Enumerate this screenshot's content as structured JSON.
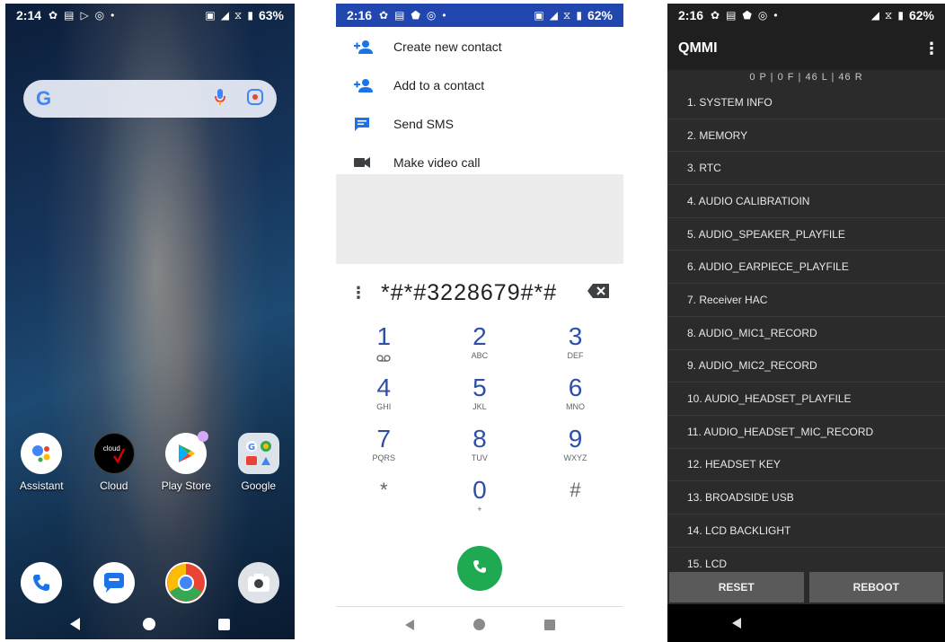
{
  "screen1": {
    "status": {
      "time": "2:14",
      "battery": "63%"
    },
    "search": {
      "logo": "G"
    },
    "apps_row1": [
      {
        "label": "Assistant",
        "icon": "assistant-icon"
      },
      {
        "label": "Cloud",
        "icon": "cloud-icon",
        "inner": "cloud"
      },
      {
        "label": "Play Store",
        "icon": "play-store-icon"
      },
      {
        "label": "Google",
        "icon": "google-folder-icon"
      }
    ],
    "dock": [
      {
        "icon": "phone-icon"
      },
      {
        "icon": "messages-icon"
      },
      {
        "icon": "chrome-icon"
      },
      {
        "icon": "camera-icon"
      }
    ]
  },
  "screen2": {
    "status": {
      "time": "2:16",
      "battery": "62%"
    },
    "menu": [
      {
        "label": "Create new contact",
        "icon": "add-person-icon"
      },
      {
        "label": "Add to a contact",
        "icon": "add-person-icon"
      },
      {
        "label": "Send SMS",
        "icon": "sms-icon"
      },
      {
        "label": "Make video call",
        "icon": "video-call-icon"
      }
    ],
    "dialed_number": "*#*#3228679#*#",
    "keypad": [
      [
        {
          "digit": "1",
          "letters": ""
        },
        {
          "digit": "2",
          "letters": "ABC"
        },
        {
          "digit": "3",
          "letters": "DEF"
        }
      ],
      [
        {
          "digit": "4",
          "letters": "GHI"
        },
        {
          "digit": "5",
          "letters": "JKL"
        },
        {
          "digit": "6",
          "letters": "MNO"
        }
      ],
      [
        {
          "digit": "7",
          "letters": "PQRS"
        },
        {
          "digit": "8",
          "letters": "TUV"
        },
        {
          "digit": "9",
          "letters": "WXYZ"
        }
      ],
      [
        {
          "digit": "*",
          "letters": ""
        },
        {
          "digit": "0",
          "letters": "+"
        },
        {
          "digit": "#",
          "letters": ""
        }
      ]
    ],
    "colors": {
      "accent": "#2e4fa8",
      "call": "#1ea952",
      "status_bar": "#2146ad"
    }
  },
  "screen3": {
    "status": {
      "time": "2:16",
      "battery": "62%"
    },
    "title": "QMMI",
    "counts": "0 P | 0 F | 46 L | 46 R",
    "items": [
      "1. SYSTEM INFO",
      "2. MEMORY",
      "3. RTC",
      "4. AUDIO CALIBRATIOIN",
      "5. AUDIO_SPEAKER_PLAYFILE",
      "6. AUDIO_EARPIECE_PLAYFILE",
      "7. Receiver HAC",
      "8. AUDIO_MIC1_RECORD",
      "9. AUDIO_MIC2_RECORD",
      "10. AUDIO_HEADSET_PLAYFILE",
      "11. AUDIO_HEADSET_MIC_RECORD",
      "12. HEADSET KEY",
      "13. BROADSIDE USB",
      "14. LCD BACKLIGHT",
      "15. LCD"
    ],
    "buttons": {
      "reset": "RESET",
      "reboot": "REBOOT"
    }
  }
}
